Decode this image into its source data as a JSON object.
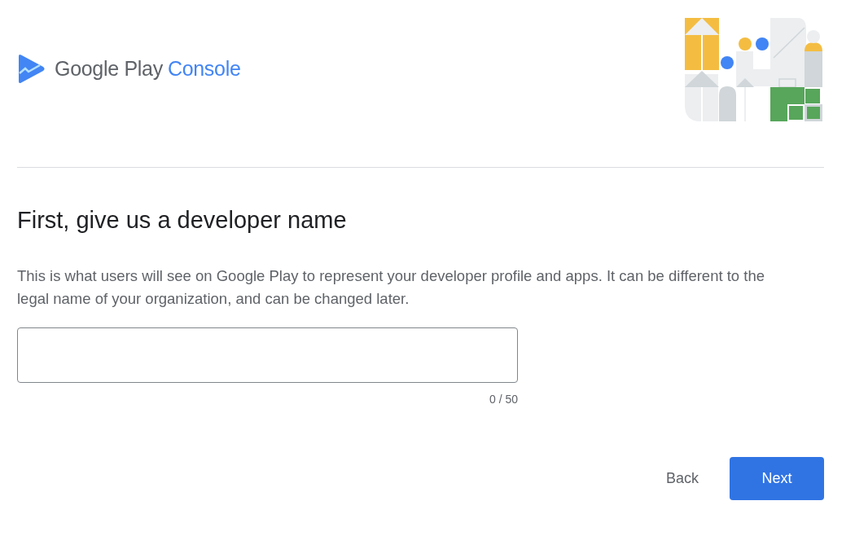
{
  "brand": {
    "name": "Google Play",
    "product": "Console"
  },
  "heading": "First, give us a developer name",
  "description": "This is what users will see on Google Play to represent your developer profile and apps. It can be different to the legal name of your organization, and can be changed later.",
  "name_field": {
    "counter": "0 / 50"
  },
  "buttons": [
    {
      "label": "Back",
      "kind": "text"
    },
    {
      "label": "Next",
      "kind": "primary"
    }
  ]
}
